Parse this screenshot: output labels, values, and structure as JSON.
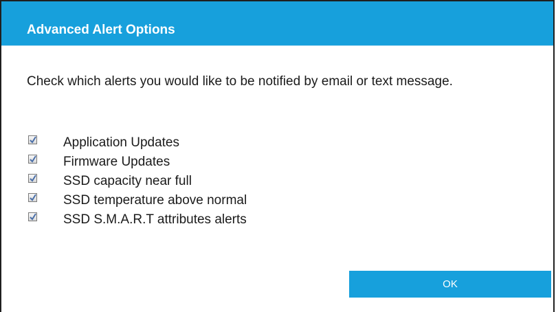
{
  "dialog": {
    "title": "Advanced Alert Options",
    "message": "Check which alerts you would like to be notified by email or text message.",
    "accent_color": "#17a0dc",
    "alerts": [
      {
        "label": "Application Updates",
        "checked": true
      },
      {
        "label": "Firmware Updates",
        "checked": true
      },
      {
        "label": "SSD capacity near full",
        "checked": true
      },
      {
        "label": "SSD temperature above normal",
        "checked": true
      },
      {
        "label": "SSD S.M.A.R.T attributes alerts",
        "checked": true
      }
    ],
    "ok_label": "OK"
  }
}
